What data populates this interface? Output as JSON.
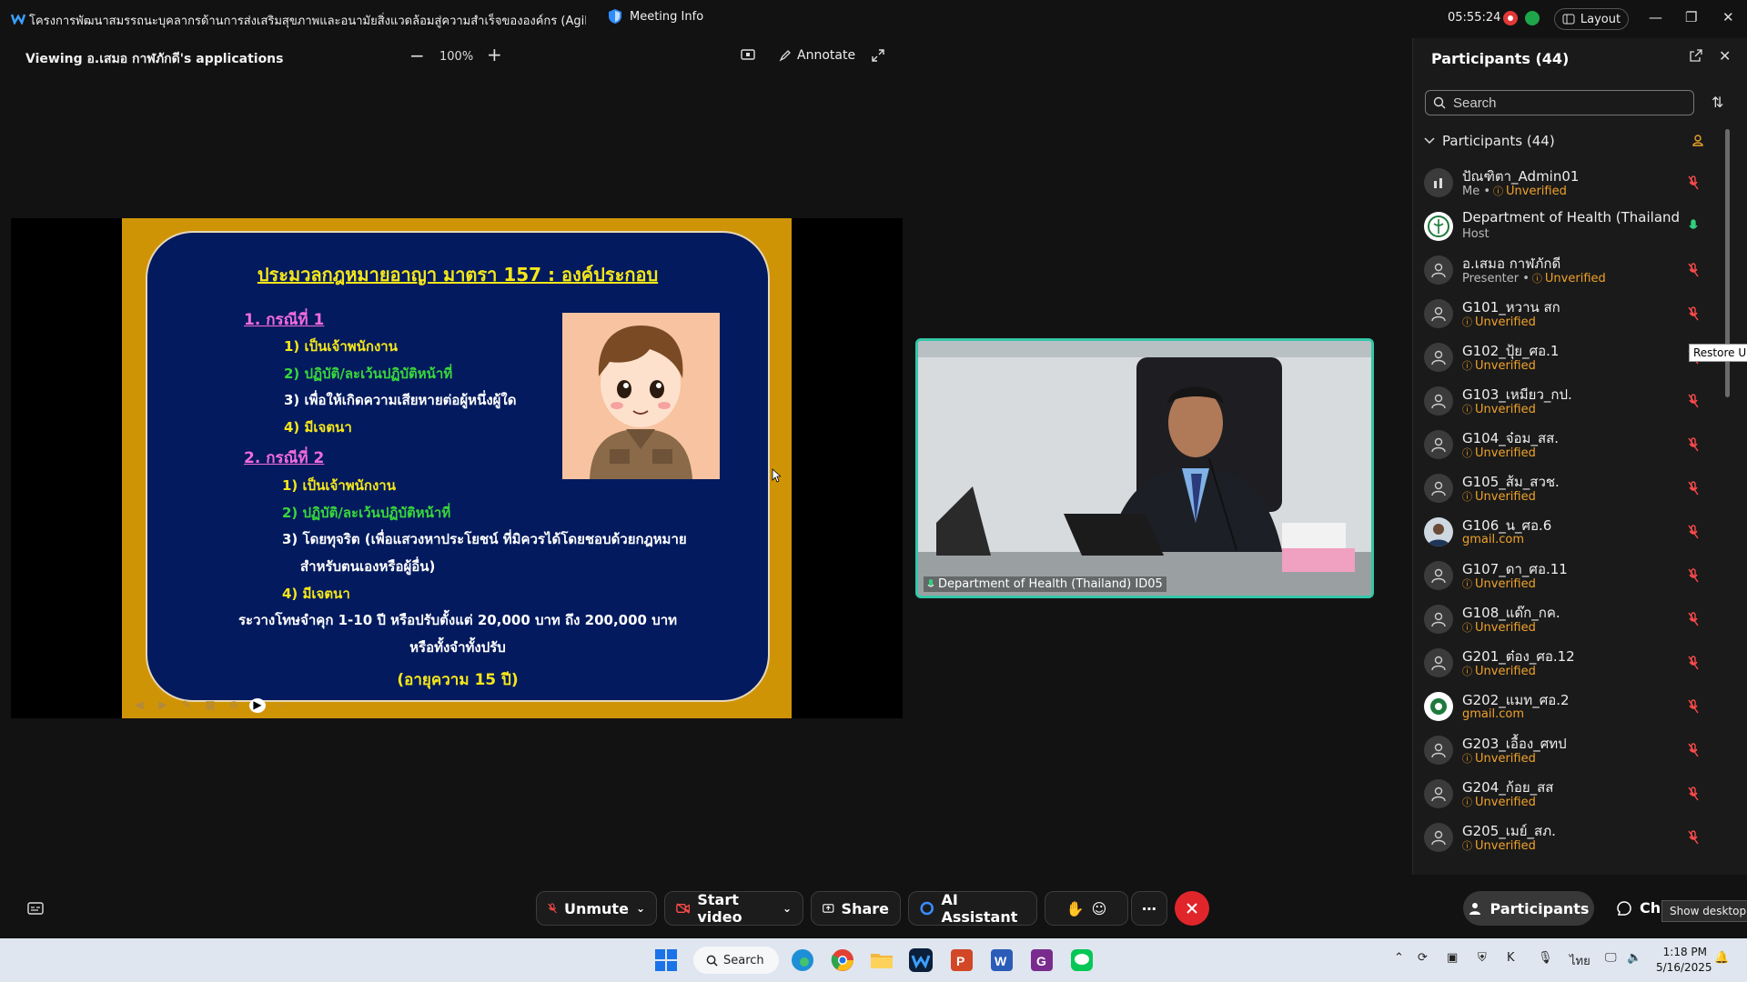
{
  "window": {
    "meeting_title": "โครงการพัฒนาสมรรถนะบุคลากรด้านการส่งเสริมสุขภาพและอนามัยสิ่งแวดล้อมสู่ความสำเร็จขององค์กร (Agility, Advanc...",
    "meeting_info_label": "Meeting Info",
    "clock": "05:55:24",
    "layout_label": "Layout"
  },
  "share_toolbar": {
    "viewing_label": "Viewing อ.เสมอ กาฬภักดี's applications",
    "zoom_level": "100%",
    "annotate_label": "Annotate"
  },
  "slide": {
    "title": "ประมวลกฎหมายอาญา มาตรา 157 : องค์ประกอบ",
    "case1_heading": "1. กรณีที่ 1",
    "case1_items": [
      "1) เป็นเจ้าพนักงาน",
      "2) ปฏิบัติ/ละเว้นปฏิบัติหน้าที่",
      "3) เพื่อให้เกิดความเสียหายต่อผู้หนึ่งผู้ใด",
      "4) มีเจตนา"
    ],
    "case2_heading": "2. กรณีที่ 2",
    "case2_items": [
      "1) เป็นเจ้าพนักงาน",
      "2) ปฏิบัติ/ละเว้นปฏิบัติหน้าที่",
      "3) โดยทุจริต (เพื่อแสวงหาประโยชน์ ที่มิควรได้โดยชอบด้วยกฎหมาย",
      "สำหรับตนเองหรือผู้อื่น)",
      "4) มีเจตนา"
    ],
    "penalty_line1": "ระวางโทษจำคุก 1-10 ปี หรือปรับตั้งแต่ 20,000 บาท ถึง 200,000 บาท",
    "penalty_line2": "หรือทั้งจำทั้งปรับ",
    "statute": "(อายุความ 15 ปี)"
  },
  "video": {
    "name": "Department of Health (Thailand) ID05"
  },
  "participants_panel": {
    "title": "Participants (44)",
    "search_placeholder": "Search",
    "group_label": "Participants (44)",
    "tooltip": "Restore Up",
    "participants": [
      {
        "name": "ปัณฑิตา_Admin01",
        "me": "Me •",
        "status": "Unverified",
        "mic": "muted",
        "avatar": "admin"
      },
      {
        "name": "Department of Health (Thailand...",
        "status": "Host",
        "mic": "active",
        "avatar": "logo"
      },
      {
        "name": "อ.เสมอ กาฬภักดี",
        "me": "Presenter •",
        "status": "Unverified",
        "mic": "muted",
        "avatar": "person"
      },
      {
        "name": "G101_หวาน สก",
        "status": "Unverified",
        "mic": "muted",
        "avatar": "person"
      },
      {
        "name": "G102_ปุ้ย_ศอ.1",
        "status": "Unverified",
        "mic": "muted",
        "avatar": "person"
      },
      {
        "name": "G103_เหมียว_กป.",
        "status": "Unverified",
        "mic": "muted",
        "avatar": "person"
      },
      {
        "name": "G104_จ๋อม_สส.",
        "status": "Unverified",
        "mic": "muted",
        "avatar": "person"
      },
      {
        "name": "G105_ส้ม_สวช.",
        "status": "Unverified",
        "mic": "muted",
        "avatar": "person"
      },
      {
        "name": "G106_น_ศอ.6",
        "status": "gmail.com",
        "mic": "muted",
        "avatar": "photo"
      },
      {
        "name": "G107_ดา_ศอ.11",
        "status": "Unverified",
        "mic": "muted",
        "avatar": "person"
      },
      {
        "name": "G108_แด๊ก_กค.",
        "status": "Unverified",
        "mic": "muted",
        "avatar": "person"
      },
      {
        "name": "G201_ต๋อง_ศอ.12",
        "status": "Unverified",
        "mic": "muted",
        "avatar": "person"
      },
      {
        "name": "G202_แมท_ศอ.2",
        "status": "gmail.com",
        "mic": "muted",
        "avatar": "logo2"
      },
      {
        "name": "G203_เอื้อง_ศทป",
        "status": "Unverified",
        "mic": "muted",
        "avatar": "person"
      },
      {
        "name": "G204_ก้อย_สส",
        "status": "Unverified",
        "mic": "muted",
        "avatar": "person"
      },
      {
        "name": "G205_เมย์_สภ.",
        "status": "Unverified",
        "mic": "muted",
        "avatar": "person"
      }
    ]
  },
  "controls": {
    "unmute_label": "Unmute",
    "start_video_label": "Start video",
    "share_label": "Share",
    "ai_assistant_label": "AI Assistant",
    "participants_label": "Participants",
    "chat_label": "Ch",
    "show_desktop_tip": "Show desktop"
  },
  "taskbar": {
    "search_label": "Search",
    "language": "ไทย",
    "time": "1:18 PM",
    "date": "5/16/2025"
  },
  "colors": {
    "accent_teal": "#34c7a8",
    "end_red": "#e1262b",
    "unverified_orange": "#f0a22a",
    "slide_navy": "#031a5e",
    "slide_gold": "#cf9406"
  }
}
